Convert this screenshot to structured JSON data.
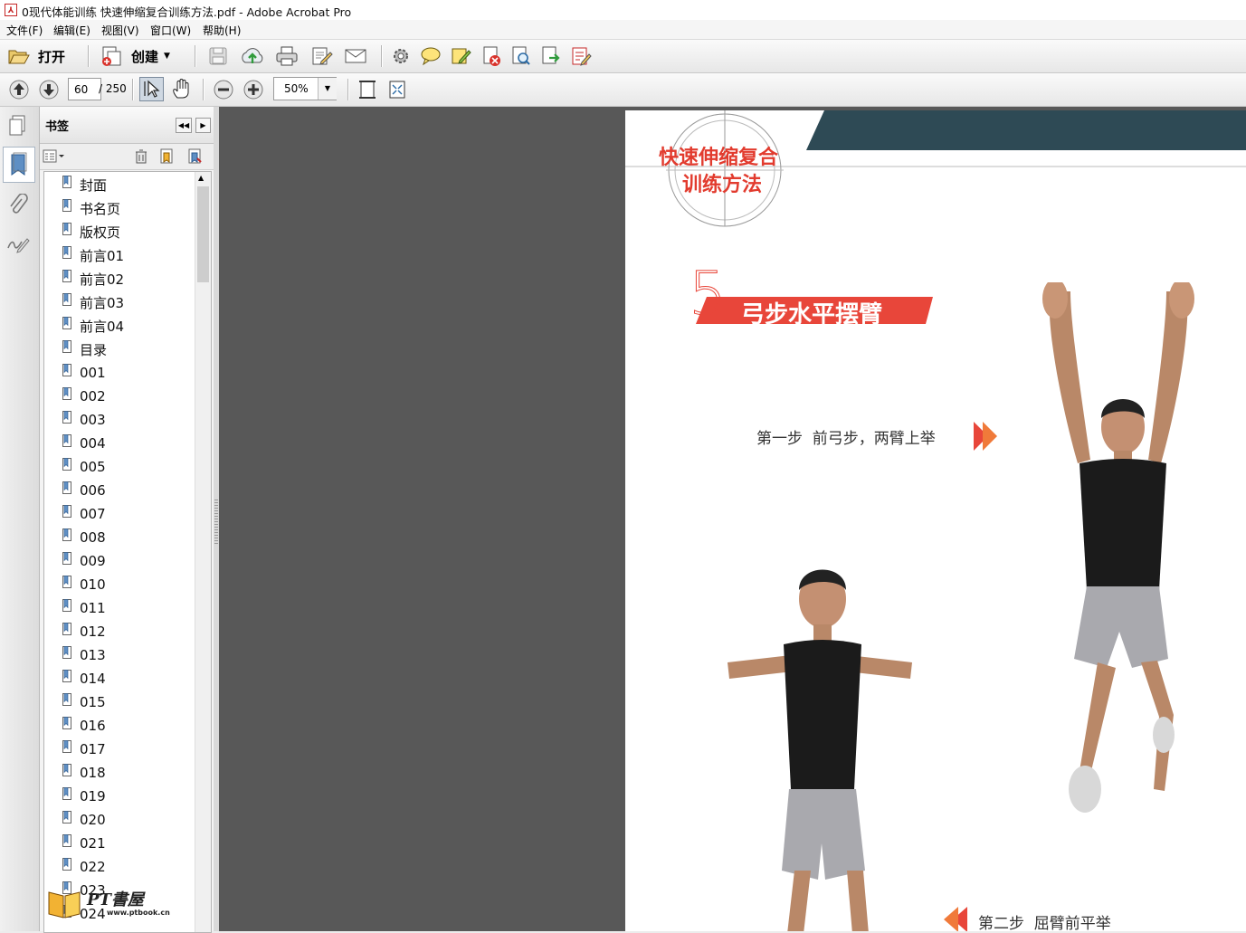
{
  "window": {
    "title": "0现代体能训练 快速伸缩复合训练方法.pdf - Adobe Acrobat Pro",
    "app_icon": "pdf-icon"
  },
  "menu": [
    {
      "label": "文件(F)"
    },
    {
      "label": "编辑(E)"
    },
    {
      "label": "视图(V)"
    },
    {
      "label": "窗口(W)"
    },
    {
      "label": "帮助(H)"
    }
  ],
  "toolbar": {
    "open_label": "打开",
    "create_label": "创建",
    "icons": [
      "folder-open-icon",
      "create-pdf-icon",
      "save-icon",
      "upload-icon",
      "print-icon",
      "edit-icon",
      "email-icon",
      "gear-icon",
      "comment-icon",
      "sign-icon",
      "delete-page-icon",
      "search-doc-icon",
      "export-icon",
      "form-icon"
    ]
  },
  "nav_toolbar": {
    "current_page": "60",
    "total_pages": "/ 250",
    "zoom": "50%"
  },
  "bookmarks_panel": {
    "title": "书签",
    "items": [
      {
        "label": "封面"
      },
      {
        "label": "书名页"
      },
      {
        "label": "版权页"
      },
      {
        "label": "前言01"
      },
      {
        "label": "前言02"
      },
      {
        "label": "前言03"
      },
      {
        "label": "前言04"
      },
      {
        "label": "目录"
      },
      {
        "label": "001"
      },
      {
        "label": "002"
      },
      {
        "label": "003"
      },
      {
        "label": "004"
      },
      {
        "label": "005"
      },
      {
        "label": "006"
      },
      {
        "label": "007"
      },
      {
        "label": "008"
      },
      {
        "label": "009"
      },
      {
        "label": "010"
      },
      {
        "label": "011"
      },
      {
        "label": "012"
      },
      {
        "label": "013"
      },
      {
        "label": "014"
      },
      {
        "label": "015"
      },
      {
        "label": "016"
      },
      {
        "label": "017"
      },
      {
        "label": "018"
      },
      {
        "label": "019"
      },
      {
        "label": "020"
      },
      {
        "label": "021"
      },
      {
        "label": "022"
      },
      {
        "label": "023"
      },
      {
        "label": "024"
      }
    ]
  },
  "watermark": {
    "text": "PT書屋",
    "url": "www.ptbook.cn"
  },
  "document": {
    "chapter_title_line1": "快速伸缩复合",
    "chapter_title_line2": "训练方法",
    "exercise_number": "5",
    "exercise_name": "弓步水平摆臂",
    "step1": "第一步  前弓步，两臂上举",
    "step2": "第二步  屈臂前平举"
  },
  "colors": {
    "accent_red": "#e8463a",
    "header_teal": "#2e4a55",
    "canvas": "#585858"
  }
}
